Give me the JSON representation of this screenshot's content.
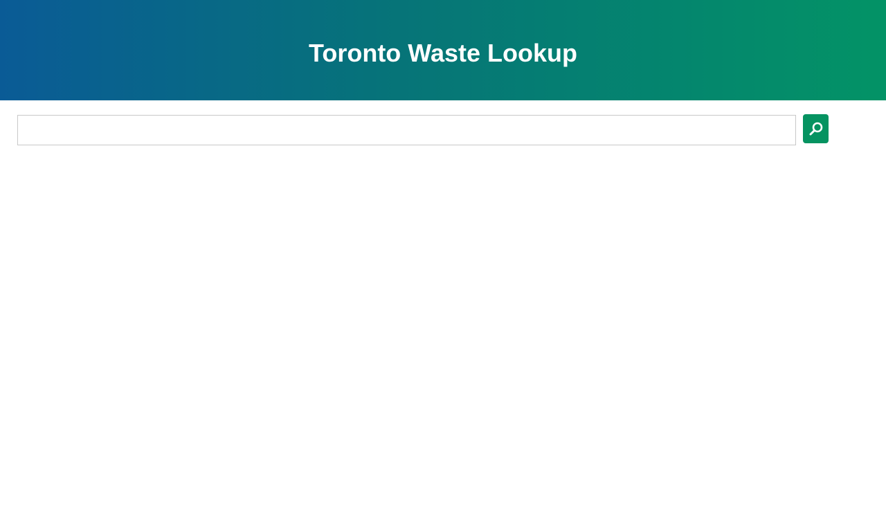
{
  "header": {
    "title": "Toronto Waste Lookup"
  },
  "search": {
    "value": "",
    "placeholder": "",
    "button_icon": "search-icon"
  },
  "colors": {
    "header_gradient_start": "#0a5b96",
    "header_gradient_end": "#039366",
    "accent_button": "#069361",
    "input_border": "#c8c8c8"
  }
}
